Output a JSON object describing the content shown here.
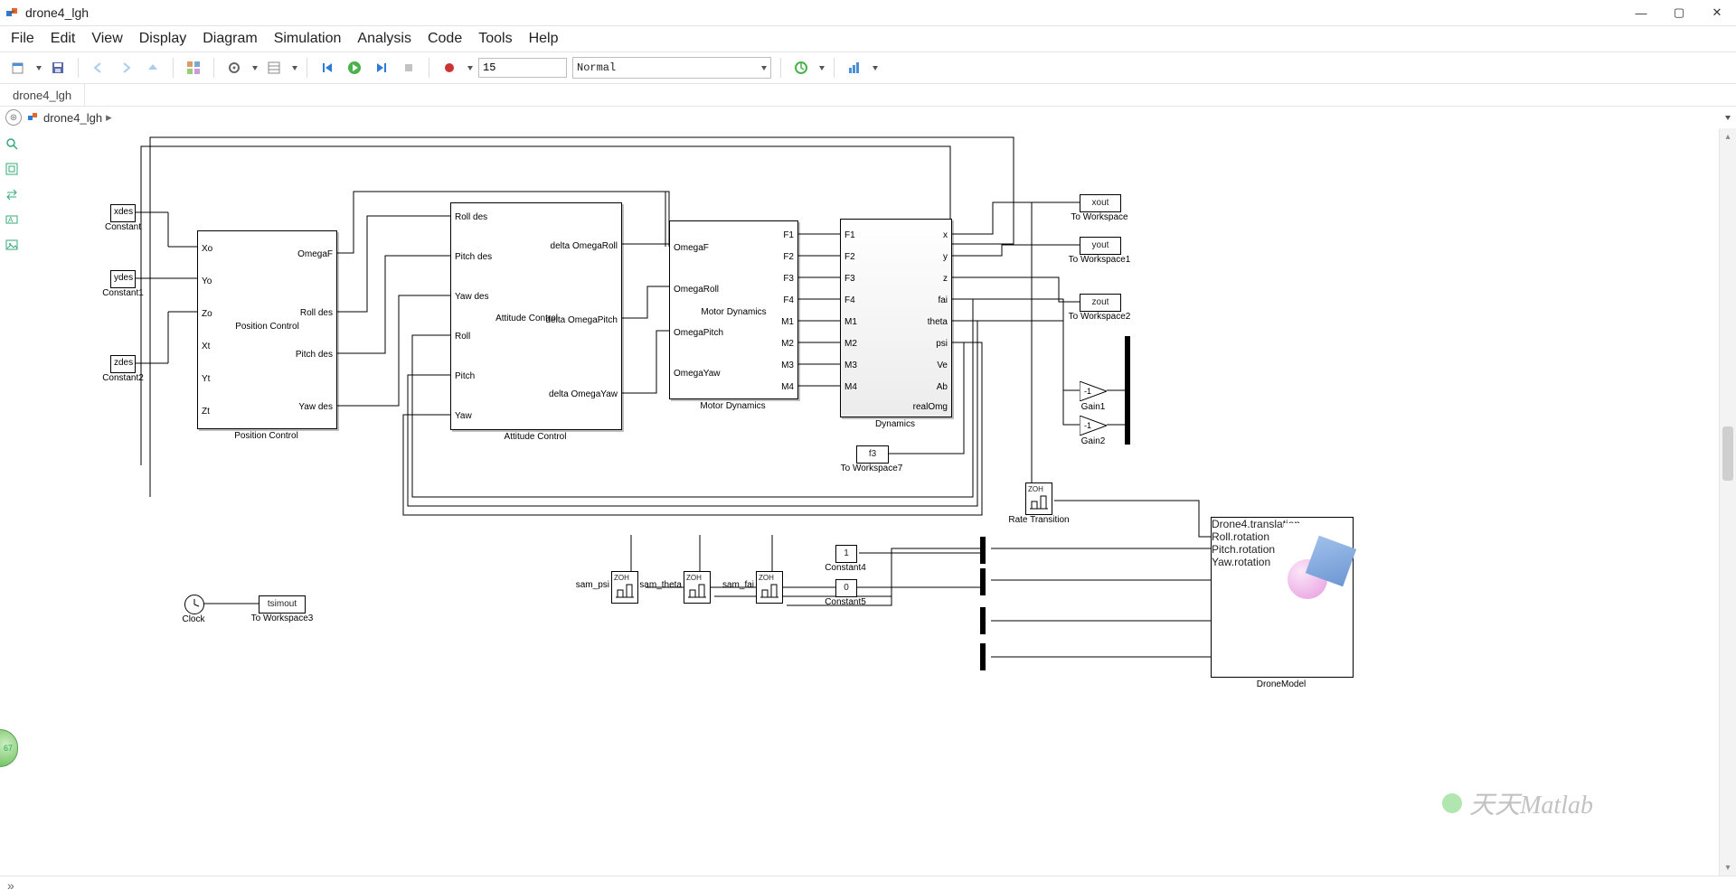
{
  "window": {
    "title": "drone4_lgh"
  },
  "menu": [
    "File",
    "Edit",
    "View",
    "Display",
    "Diagram",
    "Simulation",
    "Analysis",
    "Code",
    "Tools",
    "Help"
  ],
  "toolbar": {
    "stop_time": "15",
    "mode": "Normal"
  },
  "model_tab": "drone4_lgh",
  "breadcrumb": "drone4_lgh",
  "palette_bubble": "67",
  "blocks": {
    "constant_xdes": {
      "text": "xdes",
      "label": "Constant"
    },
    "constant_ydes": {
      "text": "ydes",
      "label": "Constant1"
    },
    "constant_zdes": {
      "text": "zdes",
      "label": "Constant2"
    },
    "position_control": {
      "label": "Position Control",
      "title": "Position Control",
      "in": [
        "Xo",
        "Yo",
        "Zo",
        "Xt",
        "Yt",
        "Zt"
      ],
      "out": [
        "OmegaF",
        "Roll des",
        "Pitch des",
        "Yaw des"
      ]
    },
    "attitude_control": {
      "label": "Attitude Control",
      "title": "Attitude Control",
      "in": [
        "Roll des",
        "Pitch des",
        "Yaw des",
        "Roll",
        "Pitch",
        "Yaw"
      ],
      "out": [
        "delta OmegaRoll",
        "delta OmegaPitch",
        "delta OmegaYaw"
      ]
    },
    "motor_dynamics": {
      "label": "Motor Dynamics",
      "title": "Motor Dynamics",
      "in": [
        "OmegaF",
        "OmegaRoll",
        "OmegaPitch",
        "OmegaYaw"
      ],
      "out": [
        "F1",
        "F2",
        "F3",
        "F4",
        "M1",
        "M2",
        "M3",
        "M4"
      ]
    },
    "dynamics": {
      "label": "Dynamics",
      "in": [
        "F1",
        "F2",
        "F3",
        "F4",
        "M1",
        "M2",
        "M3",
        "M4"
      ],
      "out": [
        "x",
        "y",
        "z",
        "fai",
        "theta",
        "psi",
        "Ve",
        "Ab",
        "realOmg"
      ]
    },
    "to_workspace_x": {
      "text": "xout",
      "label": "To Workspace"
    },
    "to_workspace_y": {
      "text": "yout",
      "label": "To Workspace1"
    },
    "to_workspace_z": {
      "text": "zout",
      "label": "To Workspace2"
    },
    "to_workspace_f3": {
      "text": "f3",
      "label": "To Workspace7"
    },
    "to_workspace_t": {
      "text": "tsimout",
      "label": "To Workspace3"
    },
    "const4": {
      "text": "1",
      "label": "Constant4"
    },
    "const5": {
      "text": "0",
      "label": "Constant5"
    },
    "gain1": {
      "text": "-1",
      "label": "Gain1"
    },
    "gain2": {
      "text": "-1",
      "label": "Gain2"
    },
    "rate_transition": {
      "zoh": "ZOH",
      "label": "Rate Transition"
    },
    "rt_sam_psi": {
      "zoh": "ZOH",
      "label": "sam_psi"
    },
    "rt_sam_theta": {
      "zoh": "ZOH",
      "label": "sam_theta"
    },
    "rt_sam_fai": {
      "zoh": "ZOH",
      "label": "sam_fai"
    },
    "clock": {
      "label": "Clock"
    },
    "vr": {
      "label": "DroneModel",
      "ports": [
        "Drone4.translation",
        "Roll.rotation",
        "Pitch.rotation",
        "Yaw.rotation"
      ]
    }
  },
  "watermark": "天天Matlab"
}
